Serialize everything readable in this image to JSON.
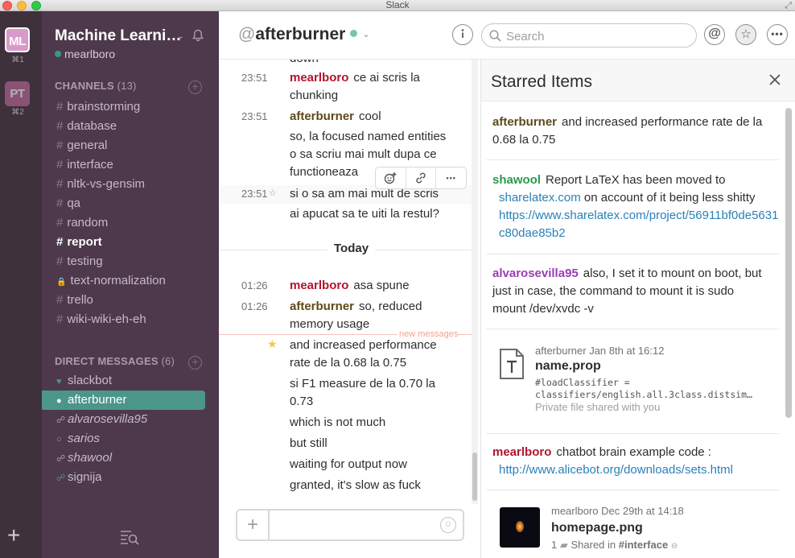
{
  "window": {
    "title": "Slack"
  },
  "teams": [
    {
      "initials": "ML",
      "shortcut": "⌘1"
    },
    {
      "initials": "PT",
      "shortcut": "⌘2"
    }
  ],
  "sidebar": {
    "team_name": "Machine Learni…",
    "user": "mearlboro",
    "channels_header": "CHANNELS",
    "channels_count": "(13)",
    "channels": [
      {
        "label": "brainstorming",
        "prefix": "#"
      },
      {
        "label": "database",
        "prefix": "#"
      },
      {
        "label": "general",
        "prefix": "#"
      },
      {
        "label": "interface",
        "prefix": "#"
      },
      {
        "label": "nltk-vs-gensim",
        "prefix": "#"
      },
      {
        "label": "qa",
        "prefix": "#"
      },
      {
        "label": "random",
        "prefix": "#"
      },
      {
        "label": "report",
        "prefix": "#"
      },
      {
        "label": "testing",
        "prefix": "#"
      },
      {
        "label": "text-normalization",
        "prefix": "🔒"
      },
      {
        "label": "trello",
        "prefix": "#"
      },
      {
        "label": "wiki-wiki-eh-eh",
        "prefix": "#"
      }
    ],
    "dm_header": "DIRECT MESSAGES",
    "dm_count": "(6)",
    "dms": [
      {
        "label": "slackbot",
        "status": "♥"
      },
      {
        "label": "afterburner",
        "status": "●"
      },
      {
        "label": "alvarosevilla95",
        "status": "☍"
      },
      {
        "label": "sarios",
        "status": "○"
      },
      {
        "label": "shawool",
        "status": "☍"
      },
      {
        "label": "signija",
        "status": "☍"
      }
    ]
  },
  "header": {
    "at": "@",
    "channel": "afterburner",
    "search_placeholder": "Search"
  },
  "messages": {
    "clipped_top": "down",
    "m1_time": "23:51",
    "m1_user": "mearlboro",
    "m1_text": "ce ai scris la chunking",
    "m2_time": "23:51",
    "m2_user": "afterburner",
    "m2_text": "cool",
    "m3_text": "so, la focused named entities o sa scriu mai mult dupa ce functioneaza",
    "m4_time": "23:51",
    "m4_text": "si o sa am mai mult de scris",
    "m5_text": "ai apucat sa te uiti la restul?",
    "day": "Today",
    "m6_time": "01:26",
    "m6_user": "mearlboro",
    "m6_text": "asa spune",
    "m7_time": "01:26",
    "m7_user": "afterburner",
    "m7_text": "so, reduced memory usage",
    "new_messages": "new messages",
    "m8_text": "and increased performance rate de la 0.68 la 0.75",
    "m9_text": "si F1 measure de la 0.70 la 0.73",
    "m10_text": "which is not much",
    "m11_text": "but still",
    "m12_text": "waiting for output now",
    "m13_text": "granted, it's slow as fuck"
  },
  "starred": {
    "title": "Starred Items",
    "i1_user": "afterburner",
    "i1_text": "and increased performance rate de la 0.68 la 0.75",
    "i2_user": "shawool",
    "i2_text": "Report LaTeX has been moved to",
    "i2_link1": "sharelatex.com",
    "i2_text2": "on account of it being less shitty",
    "i2_link2": "https://www.sharelatex.com/project/56911bf0de5631c80dae85b2",
    "i3_user": "alvarosevilla95",
    "i3_text": "also, I set it to mount on boot, but just in case, the command to mount it is sudo mount /dev/xvdc -v",
    "i4_meta": "afterburner   Jan 8th at 16:12",
    "i4_name": "name.prop",
    "i4_code1": "#loadClassifier =",
    "i4_code2": "classifiers/english.all.3class.distsim…",
    "i4_priv": "Private file shared with you",
    "i5_user": "mearlboro",
    "i5_text": "chatbot brain example code :",
    "i5_link": "http://www.alicebot.org/downloads/sets.html",
    "i6_meta": "mearlboro   Dec 29th at 14:18",
    "i6_name": "homepage.png",
    "i6_count": "1",
    "i6_shared": "Shared in",
    "i6_channel": "#interface"
  }
}
